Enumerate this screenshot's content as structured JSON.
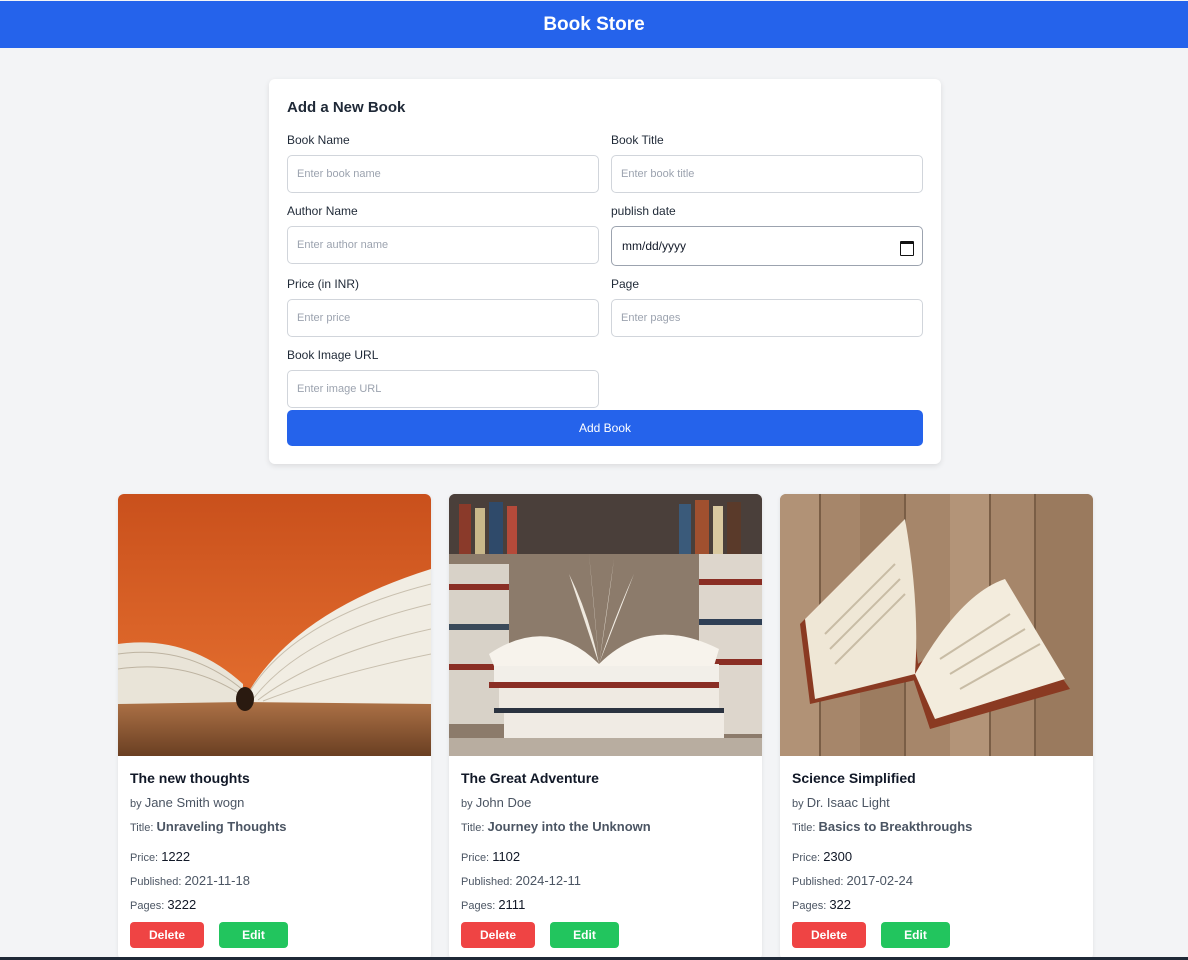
{
  "app": {
    "title": "Book Store"
  },
  "form": {
    "heading": "Add a New Book",
    "fields": {
      "book_name": {
        "label": "Book Name",
        "placeholder": "Enter book name"
      },
      "book_title": {
        "label": "Book Title",
        "placeholder": "Enter book title"
      },
      "author_name": {
        "label": "Author Name",
        "placeholder": "Enter author name"
      },
      "publish_date": {
        "label": "publish date",
        "value": "mm/dd/yyyy"
      },
      "price": {
        "label": "Price (in INR)",
        "placeholder": "Enter price"
      },
      "page": {
        "label": "Page",
        "placeholder": "Enter pages"
      },
      "image_url": {
        "label": "Book Image URL",
        "placeholder": "Enter image URL"
      }
    },
    "submit_label": "Add Book"
  },
  "labels": {
    "by": "by",
    "title": "Title:",
    "price": "Price:",
    "published": "Published:",
    "pages": "Pages:",
    "delete": "Delete",
    "edit": "Edit"
  },
  "books": [
    {
      "name": "The new thoughts",
      "author": "Jane Smith wogn",
      "title": "Unraveling Thoughts",
      "price": "1222",
      "published": "2021-11-18",
      "pages": "3222",
      "image": "open-book-orange-background"
    },
    {
      "name": "The Great Adventure",
      "author": "John Doe",
      "title": "Journey into the Unknown",
      "price": "1102",
      "published": "2024-12-11",
      "pages": "2111",
      "image": "open-book-on-stack-library"
    },
    {
      "name": "Science Simplified",
      "author": "Dr. Isaac Light",
      "title": "Basics to Breakthroughs",
      "price": "2300",
      "published": "2017-02-24",
      "pages": "322",
      "image": "open-book-on-wood-table"
    }
  ],
  "colors": {
    "primary": "#2563eb",
    "delete": "#ef4444",
    "edit": "#22c55e",
    "background": "#f3f4f6"
  }
}
